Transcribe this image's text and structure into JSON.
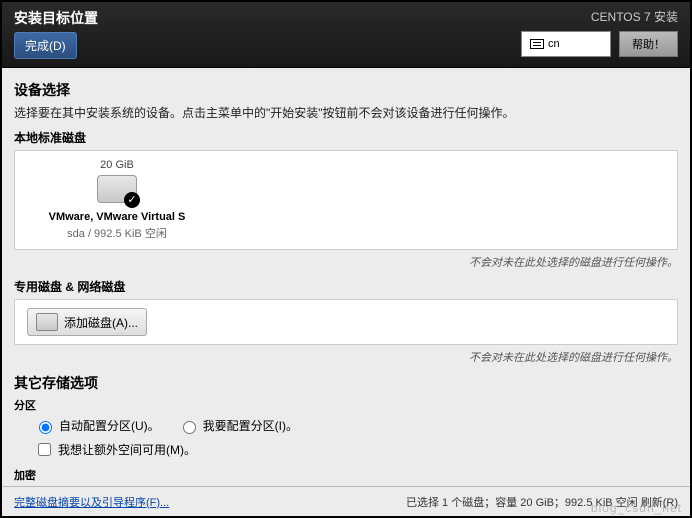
{
  "header": {
    "title": "安装目标位置",
    "done": "完成(D)",
    "subtitle": "CENTOS 7 安装",
    "lang": "cn",
    "help": "帮助！"
  },
  "device": {
    "title": "设备选择",
    "desc": "选择要在其中安装系统的设备。点击主菜单中的\"开始安装\"按钮前不会对该设备进行任何操作。",
    "local_title": "本地标准磁盘",
    "disk": {
      "size": "20 GiB",
      "name": "VMware, VMware Virtual S",
      "info": "sda   /   992.5 KiB 空闲"
    },
    "note": "不会对未在此处选择的磁盘进行任何操作。",
    "special_title": "专用磁盘 & 网络磁盘",
    "add_disk": "添加磁盘(A)..."
  },
  "storage": {
    "title": "其它存储选项",
    "partition": "分区",
    "auto": "自动配置分区(U)。",
    "manual": "我要配置分区(I)。",
    "extra": "我想让额外空间可用(M)。",
    "encrypt_title": "加密"
  },
  "footer": {
    "link": "完整磁盘摘要以及引导程序(F)...",
    "status": "已选择 1 个磁盘；容量 20 GiB；992.5 KiB 空闲 刷新(R)"
  },
  "watermark": "blog_csdn_net"
}
